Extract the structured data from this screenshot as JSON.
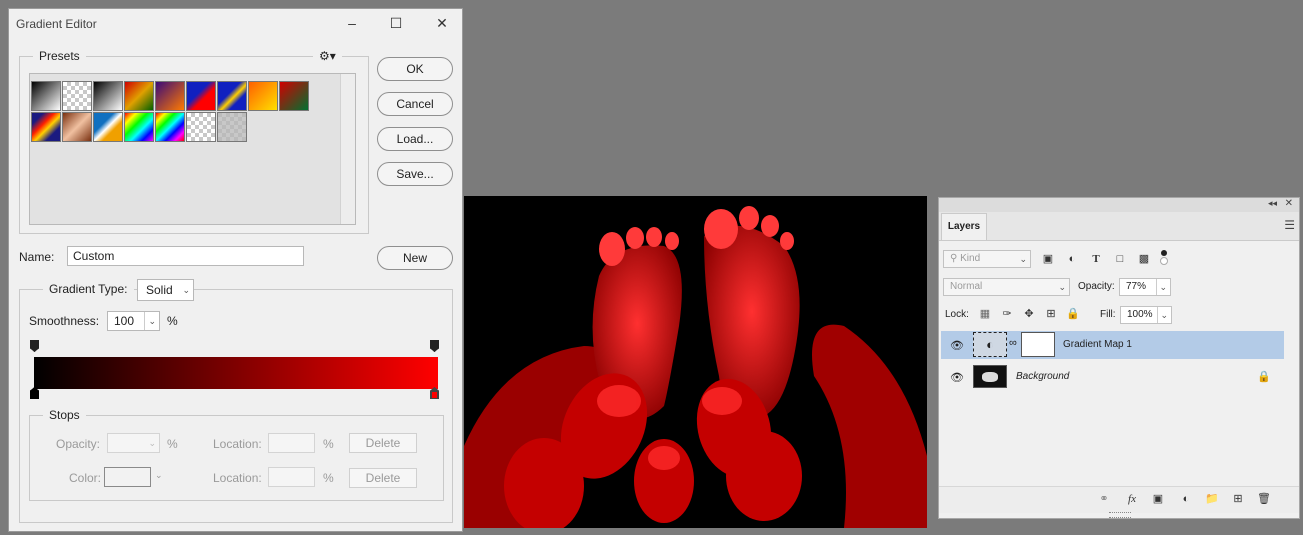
{
  "dialog": {
    "title": "Gradient Editor",
    "presets_label": "Presets",
    "buttons": {
      "ok": "OK",
      "cancel": "Cancel",
      "load": "Load...",
      "save": "Save...",
      "new": "New"
    },
    "name_label": "Name:",
    "name_value": "Custom",
    "gradient_type_label": "Gradient Type:",
    "gradient_type_value": "Solid",
    "smoothness_label": "Smoothness:",
    "smoothness_value": "100",
    "percent": "%",
    "gradient_colors": [
      "#000000",
      "#ff0000"
    ],
    "stops": {
      "label": "Stops",
      "opacity_label": "Opacity:",
      "color_label": "Color:",
      "location_label": "Location:",
      "delete_label": "Delete"
    }
  },
  "layers_panel": {
    "tab": "Layers",
    "kind_placeholder": "Kind",
    "blend_mode": "Normal",
    "opacity_label": "Opacity:",
    "opacity_value": "77%",
    "lock_label": "Lock:",
    "fill_label": "Fill:",
    "fill_value": "100%",
    "layers": [
      {
        "name": "Gradient Map 1",
        "selected": true
      },
      {
        "name": "Background",
        "selected": false,
        "locked": true
      }
    ]
  }
}
